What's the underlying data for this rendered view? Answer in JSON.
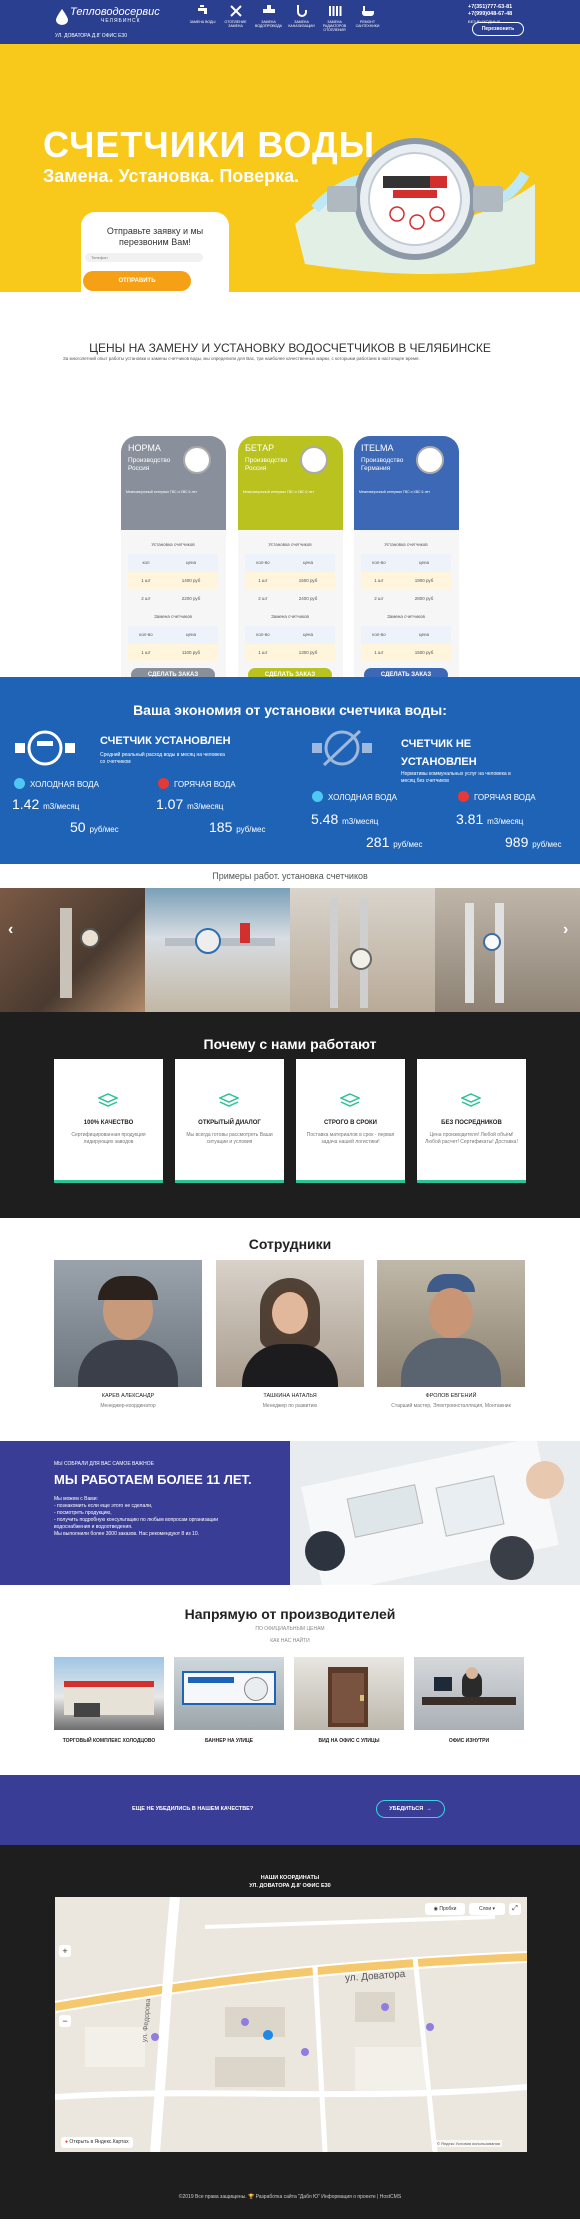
{
  "header": {
    "logo_title": "Тепловодосервис",
    "logo_subtitle": "ЧЕЛЯБИНСК",
    "address": "УЛ. ДОВАТОРА Д.8' ОФИС Е30",
    "nav": [
      {
        "label": "ЗАМЕНА ВОДЫ",
        "icon": "faucet-icon"
      },
      {
        "label": "ОТОПЛЕНИЕ ЗАМЕНА",
        "icon": "tools-icon"
      },
      {
        "label": "ЗАМЕНА ВОДОПРОВОДА",
        "icon": "pipe-tap-icon"
      },
      {
        "label": "ЗАМЕНА КАНАЛИЗАЦИИ",
        "icon": "sewer-icon"
      },
      {
        "label": "ЗАМЕНА РАДИАТОРОВ ОТОПЛЕНИЯ",
        "icon": "radiator-icon"
      },
      {
        "label": "РЕМОНТ САНТЕХНИКИ",
        "icon": "bathtub-icon"
      }
    ],
    "phones": [
      "+7(351)777-63-81",
      "+7(999)048-67-48"
    ],
    "phones_note": "БЕЗ ВЫХОДНЫХ",
    "callback_button": "Перезвонить"
  },
  "hero": {
    "title": "СЧЕТЧИКИ ВОДЫ",
    "subtitle": "Замена. Установка. Поверка.",
    "form_title": "Отправьте заявку и мы перезвоним Вам!",
    "phone_placeholder": "Телефон",
    "submit_button": "ОТПРАВИТЬ"
  },
  "prices": {
    "title": "ЦЕНЫ НА ЗАМЕНУ И УСТАНОВКУ ВОДОСЧЕТЧИКОВ В ЧЕЛЯБИНСКЕ",
    "intro": "За многолетний опыт работы установки и замены счетчиков воды, мы определили для Вас, три наиболее качественных марки, с которыми работаем в настоящее время.",
    "cards": [
      {
        "name": "НОРМА",
        "producer_label": "Производство",
        "country": "Россия",
        "spec": "Межповерочный интервал ГВС и ХВС 6 лет",
        "color": "#8a8f9c",
        "button": "СДЕЛАТЬ ЗАКАЗ",
        "sections": [
          {
            "title": "Установка счетчиков",
            "head": [
              "кол",
              "цена"
            ],
            "rows": [
              [
                "1 шт",
                "1400 руб"
              ],
              [
                "2 шт",
                "2200 руб"
              ]
            ]
          },
          {
            "title": "Замена счетчиков",
            "head": [
              "кол-во",
              "цена"
            ],
            "rows": [
              [
                "1 шт",
                "1100 руб"
              ],
              [
                "2 шт",
                "2000 руб"
              ]
            ]
          }
        ]
      },
      {
        "name": "БЕТАР",
        "producer_label": "Производство",
        "country": "Россия",
        "spec": "Межповерочный интервал ГВС и ХВС 6 лет",
        "color": "#b9c21f",
        "button": "СДЕЛАТЬ ЗАКАЗ",
        "sections": [
          {
            "title": "Установка счетчиков",
            "head": [
              "кол-во",
              "цена"
            ],
            "rows": [
              [
                "1 шт",
                "1500 руб"
              ],
              [
                "2 шт",
                "2400 руб"
              ]
            ]
          },
          {
            "title": "Замена счетчиков",
            "head": [
              "кол-во",
              "цена"
            ],
            "rows": [
              [
                "1 шт",
                "1300 руб"
              ],
              [
                "2 шт",
                "2200 руб"
              ]
            ]
          }
        ]
      },
      {
        "name": "ITELMA",
        "producer_label": "Производство",
        "country": "Германия",
        "spec": "Межповерочный интервал ГВС и ХВС 6 лет",
        "color": "#3d68b5",
        "button": "СДЕЛАТЬ ЗАКАЗ",
        "sections": [
          {
            "title": "Установка счетчиков",
            "head": [
              "кол-во",
              "цена"
            ],
            "rows": [
              [
                "1 шт",
                "1900 руб"
              ],
              [
                "2 шт",
                "2800 руб"
              ]
            ]
          },
          {
            "title": "Замена счетчиков",
            "head": [
              "кол-во",
              "цена"
            ],
            "rows": [
              [
                "1 шт",
                "1500 руб"
              ],
              [
                "2 шт",
                "2500 руб"
              ]
            ]
          }
        ]
      }
    ]
  },
  "economy": {
    "title": "Ваша экономия от установки счетчика воды:",
    "installed": {
      "label": "СЧЕТЧИК УСТАНОВЛЕН",
      "desc": "Средний реальный расход воды в месяц на человека со счетчиком",
      "cold_label": "ХОЛОДНАЯ ВОДА",
      "hot_label": "ГОРЯЧАЯ ВОДА",
      "cold_volume": "1.42",
      "hot_volume": "1.07",
      "volume_unit": "m3/месяц",
      "cold_price": "50",
      "hot_price": "185",
      "price_unit": "руб/мес"
    },
    "not_installed": {
      "label": "СЧЕТЧИК НЕ УСТАНОВЛЕН",
      "desc": "Нормативы коммунальных услуг на человека в месяц без счетчиков",
      "cold_label": "ХОЛОДНАЯ ВОДА",
      "hot_label": "ГОРЯЧАЯ ВОДА",
      "cold_volume": "5.48",
      "hot_volume": "3.81",
      "volume_unit": "m3/месяц",
      "cold_price": "281",
      "hot_price": "989",
      "price_unit": "руб/мес"
    },
    "colors": {
      "cold": "#4ec8f2",
      "hot": "#e53935"
    }
  },
  "works": {
    "title": "Примеры работ. установка счетчиков",
    "prev_arrow": "‹",
    "next_arrow": "›"
  },
  "why": {
    "title": "Почему с нами работают",
    "items": [
      {
        "name": "100% КАЧЕСТВО",
        "text": "Сертифицированная продукция лидирующих заводов"
      },
      {
        "name": "ОТКРЫТЫЙ ДИАЛОГ",
        "text": "Мы всегда готовы рассмотреть Ваши ситуации и условия"
      },
      {
        "name": "СТРОГО В СРОКИ",
        "text": "Поставка материалов в срок - первая задача нашей логистики!"
      },
      {
        "name": "БЕЗ ПОСРЕДНИКОВ",
        "text": "Цена производителя! Любой объём! Любой расчет! Сертификаты! Доставка!"
      }
    ]
  },
  "staff": {
    "title": "Сотрудники",
    "people": [
      {
        "name": "КАРЕВ АЛЕКСАНДР",
        "role": "Менеджер-координатор"
      },
      {
        "name": "ТАШКИНА НАТАЛЬЯ",
        "role": "Менеджер по развитию"
      },
      {
        "name": "ФРОЛОВ ЕВГЕНИЙ",
        "role": "Старший мастер, Электроинсталляция, Монтажник"
      }
    ]
  },
  "experience": {
    "kicker": "МЫ СОБРАЛИ ДЛЯ ВАС САМОЕ ВАЖНОЕ",
    "title": "МЫ РАБОТАЕМ БОЛЕЕ 11 ЛЕТ.",
    "lines": [
      "Мы можем с Вами:",
      "- познакомить если еще этого не сделали,",
      "- посмотреть продукцию,",
      "- получить подробную консультацию по любым вопросам организации водоснабжения и водоотведения.",
      "Мы выполнили более 3000 заказов. Нас рекомендуют 8 из 10."
    ]
  },
  "manufacturers": {
    "title": "Напрямую от производителей",
    "subtitle": "ПО ОФИЦИАЛЬНЫМ ЦЕНАМ",
    "link": "КАК НАС НАЙТИ",
    "items": [
      {
        "label": "ТОРГОВЫЙ КОМПЛЕКС ХОЛОДЦОВО"
      },
      {
        "label": "БАННЕР НА УЛИЦЕ"
      },
      {
        "label": "ВИД НА ОФИС С УЛИЦЫ"
      },
      {
        "label": "ОФИС ИЗНУТРИ"
      }
    ]
  },
  "cta": {
    "text": "ЕЩЕ НЕ УБЕДИЛИСЬ В НАШЕМ КАЧЕСТВЕ?",
    "button": "УБЕДИТЬСЯ"
  },
  "map": {
    "heading": "НАШИ КООРДИНАТЫ",
    "address": "УЛ. ДОВАТОРА Д.8' ОФИС Е30",
    "street_dovatora": "ул. Доватора",
    "street_fedorova": "ул. Федорова",
    "probki_label": "Пробки",
    "layers_label": "Слои",
    "open_link": "Открыть в Яндекс.Картах",
    "copyright": "© Яндекс Условия использования"
  },
  "footer": {
    "text": "©2019 Все права защищены. 🏆 Разработка сайта \"Дабл Ю\" Информация о проекте | HostCMS"
  }
}
